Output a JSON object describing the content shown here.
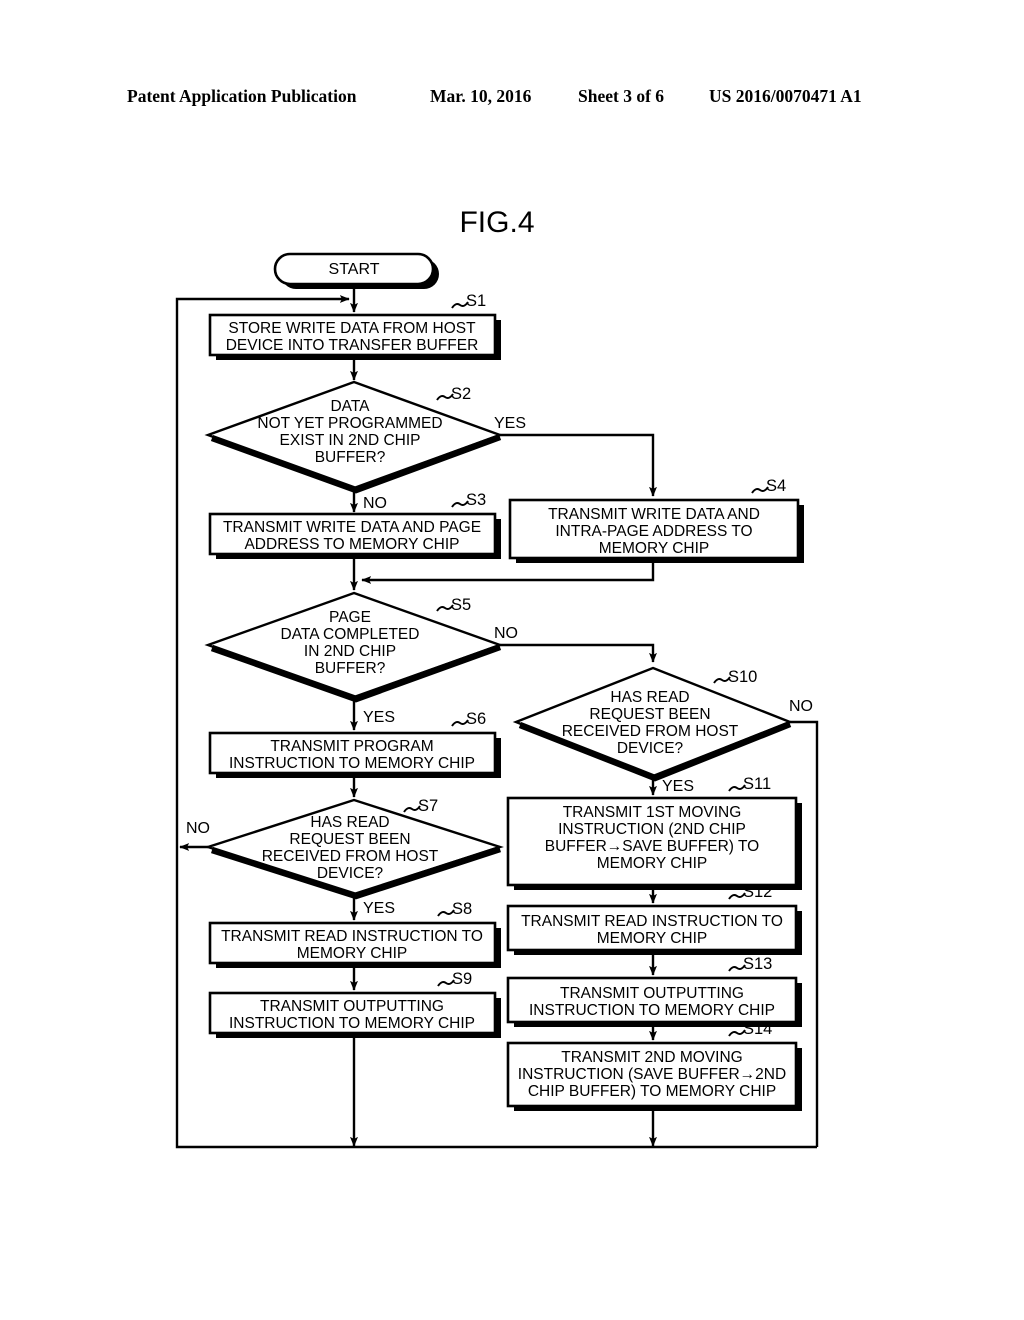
{
  "header": {
    "publication": "Patent Application Publication",
    "date": "Mar. 10, 2016",
    "sheet": "Sheet 3 of 6",
    "patent_number": "US 2016/0070471 A1"
  },
  "figure": {
    "title": "FIG.4",
    "type": "flowchart"
  },
  "nodes": {
    "start": {
      "label": "START",
      "shape": "terminator"
    },
    "s1": {
      "step": "S1",
      "shape": "process",
      "lines": [
        "STORE WRITE DATA FROM HOST",
        "DEVICE INTO TRANSFER BUFFER"
      ]
    },
    "s2": {
      "step": "S2",
      "shape": "decision",
      "lines": [
        "DATA",
        "NOT YET PROGRAMMED",
        "EXIST IN 2ND CHIP",
        "BUFFER?"
      ],
      "yes_label": "YES",
      "no_label": "NO"
    },
    "s3": {
      "step": "S3",
      "shape": "process",
      "lines": [
        "TRANSMIT WRITE DATA AND PAGE",
        "ADDRESS TO MEMORY CHIP"
      ]
    },
    "s4": {
      "step": "S4",
      "shape": "process",
      "lines": [
        "TRANSMIT WRITE DATA AND",
        "INTRA-PAGE ADDRESS TO",
        "MEMORY CHIP"
      ]
    },
    "s5": {
      "step": "S5",
      "shape": "decision",
      "lines": [
        "PAGE",
        "DATA COMPLETED",
        "IN 2ND CHIP",
        "BUFFER?"
      ],
      "yes_label": "YES",
      "no_label": "NO"
    },
    "s6": {
      "step": "S6",
      "shape": "process",
      "lines": [
        "TRANSMIT PROGRAM",
        "INSTRUCTION TO MEMORY CHIP"
      ]
    },
    "s7": {
      "step": "S7",
      "shape": "decision",
      "lines": [
        "HAS READ",
        "REQUEST BEEN",
        "RECEIVED FROM HOST",
        "DEVICE?"
      ],
      "yes_label": "YES",
      "no_label": "NO"
    },
    "s8": {
      "step": "S8",
      "shape": "process",
      "lines": [
        "TRANSMIT READ INSTRUCTION TO",
        "MEMORY CHIP"
      ]
    },
    "s9": {
      "step": "S9",
      "shape": "process",
      "lines": [
        "TRANSMIT OUTPUTTING",
        "INSTRUCTION TO MEMORY CHIP"
      ]
    },
    "s10": {
      "step": "S10",
      "shape": "decision",
      "lines": [
        "HAS READ",
        "REQUEST BEEN",
        "RECEIVED FROM HOST",
        "DEVICE?"
      ],
      "yes_label": "YES",
      "no_label": "NO"
    },
    "s11": {
      "step": "S11",
      "shape": "process",
      "lines": [
        "TRANSMIT 1ST MOVING",
        "INSTRUCTION (2ND CHIP",
        "BUFFER→SAVE BUFFER) TO",
        "MEMORY CHIP"
      ]
    },
    "s12": {
      "step": "S12",
      "shape": "process",
      "lines": [
        "TRANSMIT READ INSTRUCTION TO",
        "MEMORY CHIP"
      ]
    },
    "s13": {
      "step": "S13",
      "shape": "process",
      "lines": [
        "TRANSMIT OUTPUTTING",
        "INSTRUCTION TO MEMORY CHIP"
      ]
    },
    "s14": {
      "step": "S14",
      "shape": "process",
      "lines": [
        "TRANSMIT 2ND MOVING",
        "INSTRUCTION (SAVE BUFFER→2ND",
        "CHIP BUFFER) TO MEMORY CHIP"
      ]
    }
  },
  "flow": {
    "edges": [
      {
        "from": "start",
        "to": "s1",
        "label": ""
      },
      {
        "from": "s1",
        "to": "s2",
        "label": ""
      },
      {
        "from": "s2",
        "to": "s3",
        "label": "NO"
      },
      {
        "from": "s2",
        "to": "s4",
        "label": "YES"
      },
      {
        "from": "s3",
        "to": "s5",
        "label": ""
      },
      {
        "from": "s4",
        "to": "s5",
        "label": ""
      },
      {
        "from": "s5",
        "to": "s6",
        "label": "YES"
      },
      {
        "from": "s5",
        "to": "s10",
        "label": "NO"
      },
      {
        "from": "s6",
        "to": "s7",
        "label": ""
      },
      {
        "from": "s7",
        "to": "s8",
        "label": "YES"
      },
      {
        "from": "s7",
        "to": "s1",
        "label": "NO"
      },
      {
        "from": "s8",
        "to": "s9",
        "label": ""
      },
      {
        "from": "s9",
        "to": "s1",
        "label": ""
      },
      {
        "from": "s10",
        "to": "s11",
        "label": "YES"
      },
      {
        "from": "s10",
        "to": "s1",
        "label": "NO"
      },
      {
        "from": "s11",
        "to": "s12",
        "label": ""
      },
      {
        "from": "s12",
        "to": "s13",
        "label": ""
      },
      {
        "from": "s13",
        "to": "s14",
        "label": ""
      },
      {
        "from": "s14",
        "to": "s1",
        "label": ""
      }
    ]
  },
  "colors": {
    "ink": "#000000",
    "paper": "#ffffff"
  }
}
